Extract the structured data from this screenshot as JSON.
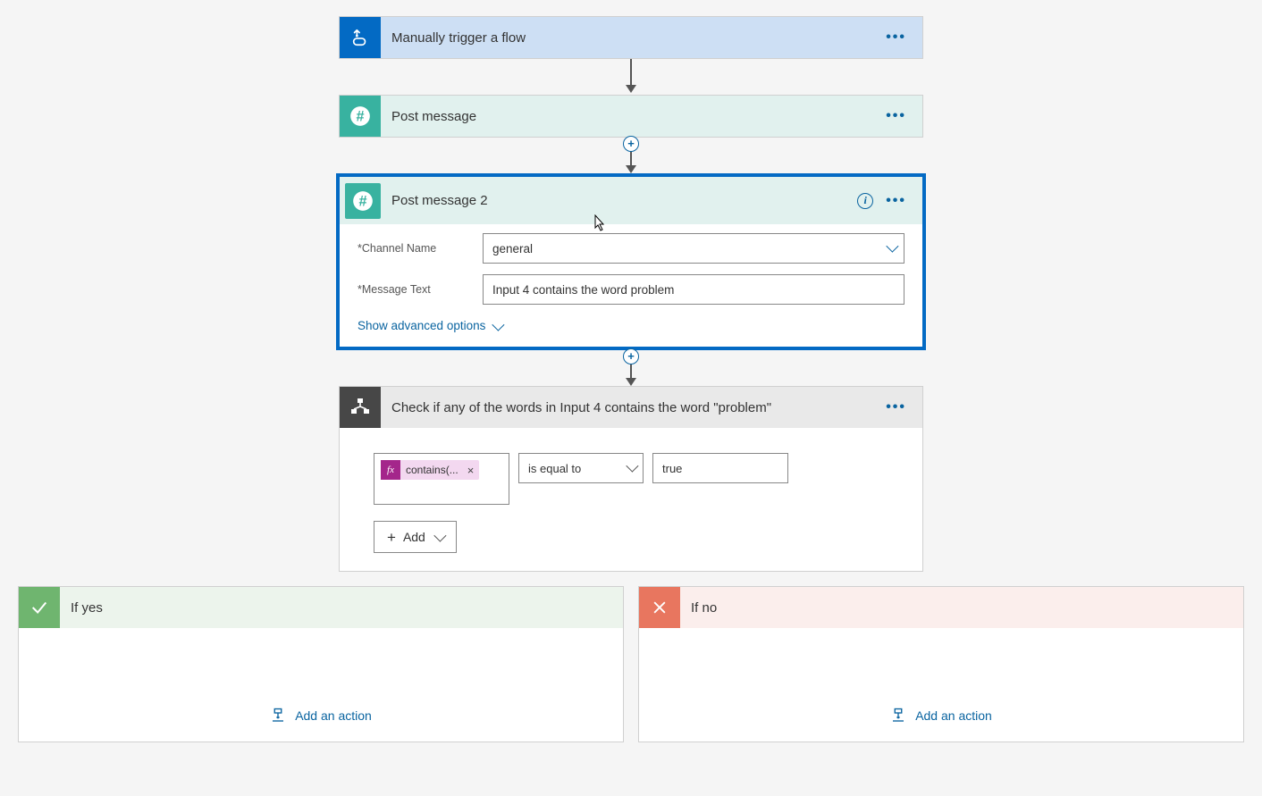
{
  "trigger": {
    "title": "Manually trigger a flow"
  },
  "post1": {
    "title": "Post message"
  },
  "post2": {
    "title": "Post message 2",
    "channel_label": "*Channel Name",
    "channel_value": "general",
    "msg_label": "*Message Text",
    "msg_value": "Input 4 contains the word problem",
    "adv": "Show advanced options"
  },
  "condition": {
    "title": "Check if any of the words in Input 4 contains the word \"problem\"",
    "fx_label": "contains(...",
    "operator": "is equal to",
    "value": "true",
    "add": "Add"
  },
  "branches": {
    "yes": {
      "title": "If yes",
      "add": "Add an action"
    },
    "no": {
      "title": "If no",
      "add": "Add an action"
    }
  }
}
